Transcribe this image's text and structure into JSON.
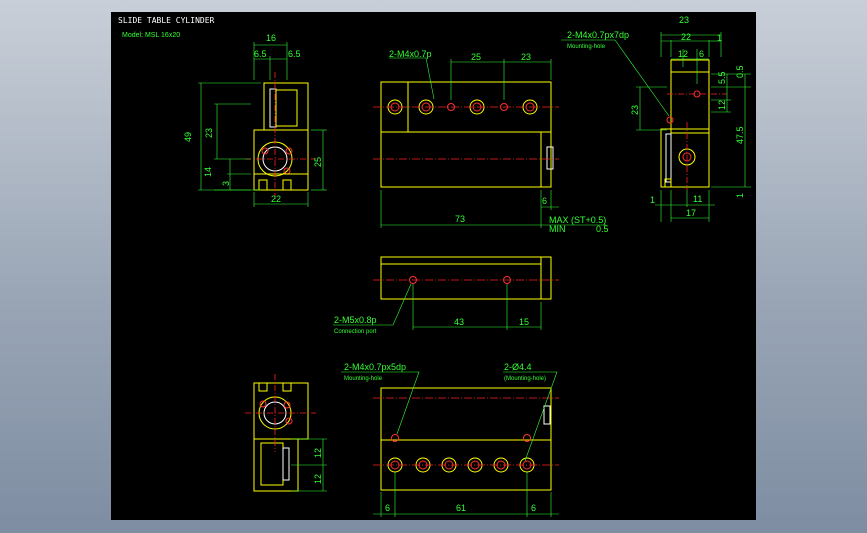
{
  "drawing": {
    "title": "SLIDE TABLE CYLINDER",
    "model": "Model:  MSL 16x20"
  },
  "colors": {
    "background": "#000000",
    "outline": "#ffff00",
    "dimension": "#33ff33",
    "centerline": "#ff2020",
    "hidden": "#ffffff"
  },
  "front_view": {
    "callout": "2-M4x0.7p",
    "d_25": "25",
    "d_23": "23",
    "d_73": "73",
    "d_6": "6",
    "max_label": "MAX",
    "max_value": "(ST+0.5)",
    "min_label": "MIN",
    "min_value": "0.5"
  },
  "left_view": {
    "d_16": "16",
    "d_6_5a": "6.5",
    "d_6_5b": "6.5",
    "d_49": "49",
    "d_23": "23",
    "d_25": "25",
    "d_14": "14",
    "d_3": "3",
    "d_22": "22"
  },
  "right_view": {
    "callout": "2-M4x0.7px7dp",
    "callout_sub": "Mounting-hole",
    "d_23": "23",
    "d_22": "22",
    "d_1a": "1",
    "d_12": "12",
    "d_6": "6",
    "d_5_5": "5.5",
    "d_0_5": "0.5",
    "d_12v": "12",
    "d_23v": "23",
    "d_47_5": "47.5",
    "d_1b": "1",
    "d_1c": "1",
    "d_11": "11",
    "d_17": "17"
  },
  "top_view": {
    "callout": "2-M5x0.8p",
    "callout_sub": "Connection port",
    "d_43": "43",
    "d_15": "15"
  },
  "bottom_view": {
    "callout_left": "2-M4x0.7px5dp",
    "callout_left_sub": "Mounting-hole",
    "callout_right": "2-Ø4.4",
    "callout_right_sub": "(Mounting-hole)",
    "d_6a": "6",
    "d_61": "61",
    "d_6b": "6"
  },
  "bottom_left_view": {
    "d_12a": "12",
    "d_12b": "12"
  }
}
